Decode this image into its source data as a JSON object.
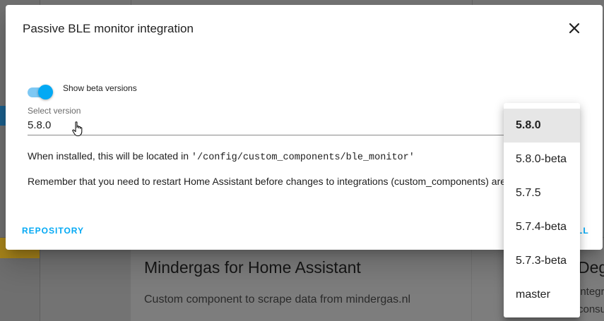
{
  "background": {
    "card_title": "Mindergas for Home Assistant",
    "card_description": "Custom component to scrape data from mindergas.nl",
    "right_card_title": "Deg",
    "right_card_desc_1": "integr",
    "right_card_desc_2": "consu"
  },
  "dialog": {
    "title": "Passive BLE monitor integration",
    "close_icon": "close-icon",
    "beta_toggle": {
      "label": "Show beta versions",
      "checked": true
    },
    "select": {
      "label": "Select version",
      "value": "5.8.0"
    },
    "install_location_prefix": "When installed, this will be located in",
    "install_location_path": "'/config/custom_components/ble_monitor'",
    "restart_notice": "Remember that you need to restart Home Assistant before changes to integrations (custom_components) are applied.",
    "repository_button": "REPOSITORY",
    "install_button": "LL"
  },
  "version_menu": {
    "selected": "5.8.0",
    "options": [
      "5.8.0",
      "5.8.0-beta",
      "5.7.5",
      "5.7.4-beta",
      "5.7.3-beta",
      "master"
    ]
  },
  "colors": {
    "accent": "#03a9f4",
    "toggle_track": "#7ec8f3",
    "selected_option_bg": "#e6e6e6",
    "scrim": "#737373"
  }
}
